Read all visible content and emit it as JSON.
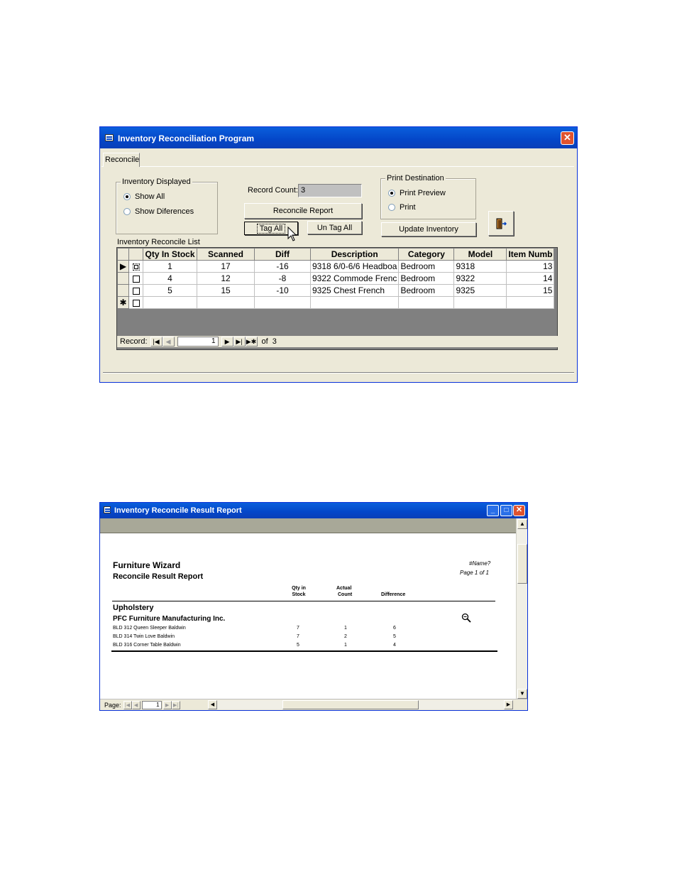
{
  "window1": {
    "title": "Inventory Reconciliation Program",
    "tab_label": "Reconcile",
    "inventory_displayed": {
      "label": "Inventory Displayed",
      "options": [
        {
          "label": "Show All",
          "selected": true
        },
        {
          "label": "Show Diferences",
          "selected": false
        }
      ]
    },
    "record_count": {
      "label": "Record Count:",
      "value": "3"
    },
    "buttons": {
      "reconcile_report": "Reconcile Report",
      "tag_all": "Tag All",
      "untag_all": "Un Tag All",
      "update_inventory": "Update Inventory",
      "exit_icon": "exit-door-icon"
    },
    "print_destination": {
      "label": "Print Destination",
      "options": [
        {
          "label": "Print Preview",
          "selected": true
        },
        {
          "label": "Print",
          "selected": false
        }
      ]
    },
    "list_label": "Inventory Reconcile List",
    "grid": {
      "columns": [
        "Qty In Stock",
        "Scanned",
        "Diff",
        "Description",
        "Category",
        "Model",
        "Item Numb"
      ],
      "rows": [
        {
          "tagged": false,
          "qty": "1",
          "scanned": "17",
          "diff": "-16",
          "description": "9318 6/0-6/6 Headboa",
          "category": "Bedroom",
          "model": "9318",
          "item": "13"
        },
        {
          "tagged": false,
          "qty": "4",
          "scanned": "12",
          "diff": "-8",
          "description": "9322 Commode Frenc",
          "category": "Bedroom",
          "model": "9322",
          "item": "14"
        },
        {
          "tagged": false,
          "qty": "5",
          "scanned": "15",
          "diff": "-10",
          "description": "9325 Chest French",
          "category": "Bedroom",
          "model": "9325",
          "item": "15"
        }
      ]
    },
    "navigation": {
      "label": "Record:",
      "current": "1",
      "of_label": "of",
      "total": "3"
    }
  },
  "window2": {
    "title": "Inventory Reconcile Result Report",
    "company": "Furniture Wizard",
    "report_title": "Reconcile Result Report",
    "name_field": "#Name?",
    "page_info": "Page 1 of 1",
    "headers": {
      "qty_line1": "Qty in",
      "qty_line2": "Stock",
      "actual_line1": "Actual",
      "actual_line2": "Count",
      "difference": "Difference"
    },
    "category": "Upholstery",
    "vendor": "PFC Furniture Manufacturing Inc.",
    "rows": [
      {
        "item": "BLD 312 Queen Sleeper Baldwin",
        "qty": "7",
        "actual": "1",
        "diff": "6"
      },
      {
        "item": "BLD 314 Twin Love Baldwin",
        "qty": "7",
        "actual": "2",
        "diff": "5"
      },
      {
        "item": "BLD 316 Corner Table Baldwin",
        "qty": "5",
        "actual": "1",
        "diff": "4"
      }
    ],
    "page_nav": {
      "label": "Page:",
      "current": "1"
    }
  }
}
